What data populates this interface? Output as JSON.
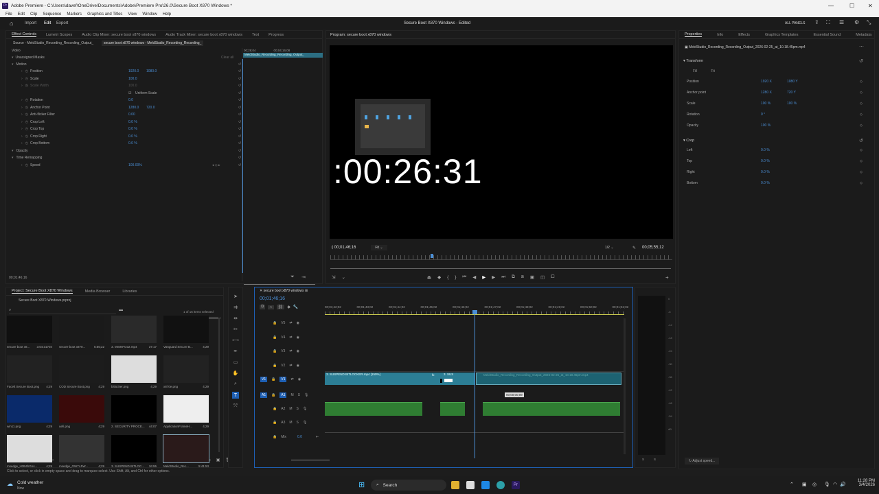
{
  "window": {
    "title": "Adobe Premiere - C:\\Users\\davef\\OneDrive\\Documents\\Adobe\\Premiere Pro\\26.0\\Secure Boot X870 Windows *"
  },
  "menu": [
    "File",
    "Edit",
    "Clip",
    "Sequence",
    "Markers",
    "Graphics and Titles",
    "View",
    "Window",
    "Help"
  ],
  "appbar": {
    "import": "Import",
    "edit": "Edit",
    "export": "Export",
    "project_title": "Secure Boot X870 Windows",
    "edited": "- Edited",
    "all_panels": "ALL PANELS"
  },
  "effect_controls": {
    "tabs": [
      "Effect Controls",
      "Lumetri Scopes",
      "Audio Clip Mixer: secure boot x870 windows",
      "Audio Track Mixer: secure boot x870 windows",
      "Text",
      "Progress"
    ],
    "source": "Source - MeldStudio_Recording_Recording_Output_",
    "clip": "secure boot x870 windows - MeldStudio_Recording_Recording_",
    "time_start": "00;28;04",
    "time_end": "00;04;16;08",
    "clip_bar": "MeldStudio_Recording_Recording_Output_",
    "video": "Video",
    "unassigned": "Unassigned Masks",
    "clear_all": "Clear all",
    "rows": [
      {
        "name": "Motion",
        "v1": "",
        "v2": ""
      },
      {
        "name": "Position",
        "v1": "1920.0",
        "v2": "1080.0"
      },
      {
        "name": "Scale",
        "v1": "100.0",
        "v2": ""
      },
      {
        "name": "Scale Width",
        "v1": "100.0",
        "v2": ""
      },
      {
        "name": "Uniform Scale",
        "v1": "",
        "v2": ""
      },
      {
        "name": "Rotation",
        "v1": "0.0",
        "v2": ""
      },
      {
        "name": "Anchor Point",
        "v1": "1280.0",
        "v2": "720.0"
      },
      {
        "name": "Anti-flicker Filter",
        "v1": "0.00",
        "v2": ""
      },
      {
        "name": "Crop Left",
        "v1": "0.0 %",
        "v2": ""
      },
      {
        "name": "Crop Top",
        "v1": "0.0 %",
        "v2": ""
      },
      {
        "name": "Crop Right",
        "v1": "0.0 %",
        "v2": ""
      },
      {
        "name": "Crop Bottom",
        "v1": "0.0 %",
        "v2": ""
      },
      {
        "name": "Opacity",
        "v1": "",
        "v2": ""
      },
      {
        "name": "Time Remapping",
        "v1": "",
        "v2": ""
      },
      {
        "name": "Speed",
        "v1": "100.00%",
        "v2": ""
      }
    ],
    "timecode": "00;01;46;16"
  },
  "program": {
    "title": "Program: secure boot x870 windows",
    "overlay_time": ":00:26:31",
    "timecode": "00;01;46;16",
    "fit": "Fit",
    "zoom": "1/2",
    "duration": "00;05;55;12"
  },
  "properties": {
    "tabs": [
      "Properties",
      "Info",
      "Effects",
      "Graphics Templates",
      "Essential Sound",
      "Metadata"
    ],
    "file": "MeldStudio_Recording_Recording_Output_2026-02-25_at_10.18.45pm.mp4",
    "transform": "Transform",
    "fill": "Fill",
    "fit": "Fit",
    "rows": [
      {
        "k": "Position",
        "v": "1920 X",
        "v2": "1080 Y"
      },
      {
        "k": "Anchor point",
        "v": "1280 X",
        "v2": "720 Y"
      },
      {
        "k": "Scale",
        "v": "100 %",
        "v2": "100 %"
      },
      {
        "k": "Rotation",
        "v": "0 °",
        "v2": ""
      },
      {
        "k": "Opacity",
        "v": "100 %",
        "v2": ""
      }
    ],
    "crop": "Crop",
    "crop_rows": [
      {
        "k": "Left",
        "v": "0.0 %"
      },
      {
        "k": "Top",
        "v": "0.0 %"
      },
      {
        "k": "Right",
        "v": "0.0 %"
      },
      {
        "k": "Bottom",
        "v": "0.0 %"
      }
    ],
    "adjust": "Adjust speed..."
  },
  "project": {
    "tabs": [
      "Project: Secure Boot X870 Windows",
      "Media Browser",
      "Libraries"
    ],
    "file": "Secure Boot X870 Windows.prproj",
    "selected": "1 of 16 items selected",
    "items": [
      {
        "name": "secure boot x8...",
        "dur": "3:54:31704"
      },
      {
        "name": "secure boot x870...",
        "dur": "5:55;22"
      },
      {
        "name": "3. MSINFO32.mp4",
        "dur": "37:17"
      },
      {
        "name": "Vanguard Secure B...",
        "dur": "4;29"
      },
      {
        "name": "Facelt Secure Boot.png",
        "dur": "4;29"
      },
      {
        "name": "COD Secure Boot.png",
        "dur": "4;29"
      },
      {
        "name": "bitlocker.png",
        "dur": "4;29"
      },
      {
        "name": "x870e.png",
        "dur": "4;29"
      },
      {
        "name": "win11.png",
        "dur": "4;29"
      },
      {
        "name": "uefi.png",
        "dur": "4;29"
      },
      {
        "name": "2. SECURITY PROCE...",
        "dur": "44:07"
      },
      {
        "name": "ApplicationFrameH...",
        "dur": "4;29"
      },
      {
        "name": "msedge_H3B4hGnv...",
        "dur": "4;29"
      },
      {
        "name": "msedge_OW7cJiW...",
        "dur": "4;29"
      },
      {
        "name": "3. SUSPEND BITLOC...",
        "dur": "16:55"
      },
      {
        "name": "MeldStudio_Rec...",
        "dur": "5:41:53"
      }
    ]
  },
  "timeline": {
    "tab": "secure boot x870 windows",
    "timecode": "00;01;46;16",
    "ruler": [
      "00;01;42;02",
      "00;01;43;02",
      "00;01;44;02",
      "00;01;45;02",
      "00;01;46;02",
      "00;01;47;02",
      "00;01;48;02",
      "00;01;49;02",
      "00;01;50;02",
      "00;01;51;02",
      "00;01;5"
    ],
    "tracks": [
      "V5",
      "V4",
      "V3",
      "V2",
      "V1",
      "A1",
      "A2",
      "A3",
      "Mix"
    ],
    "mix_val": "0.0",
    "clip1": "3. SUSPEND BITLOCKER.mp4 [150%]",
    "clip2": "3. SUS",
    "clip3": "MeldStudio_Recording_Recording_Output_2026-02-25_at_10.18.45pm.mp4",
    "tooltip": "00;00;00;09"
  },
  "status": "Click to select, or click in empty space and drag to marquee select. Use Shift, Alt, and Ctrl for other options.",
  "meter": [
    "0",
    "-6",
    "-12",
    "-18",
    "-24",
    "-30",
    "-36",
    "-42",
    "-48",
    "-54",
    "dB"
  ],
  "taskbar": {
    "weather": "Cold weather",
    "weather_sub": "Now",
    "search": "Search",
    "time": "11:28 PM",
    "date": "3/4/2026"
  }
}
